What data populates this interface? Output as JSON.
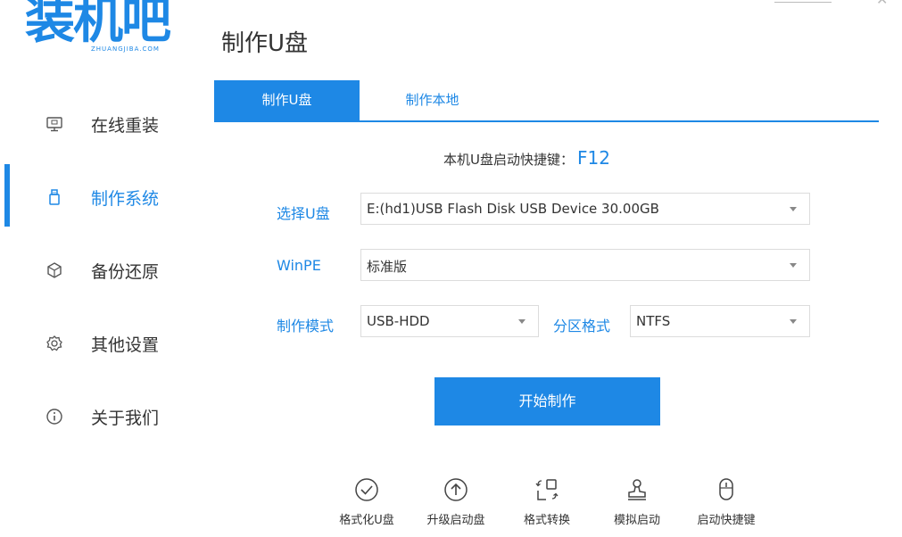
{
  "logo": {
    "main": "装机吧",
    "sub": "ZHUANGJIBA.COM"
  },
  "page_title": "制作U盘",
  "sidebar": {
    "items": [
      {
        "label": "在线重装",
        "icon": "monitor-icon"
      },
      {
        "label": "制作系统",
        "icon": "usb-icon"
      },
      {
        "label": "备份还原",
        "icon": "cube-icon"
      },
      {
        "label": "其他设置",
        "icon": "gear-icon"
      },
      {
        "label": "关于我们",
        "icon": "info-icon"
      }
    ],
    "active_index": 1
  },
  "tabs": [
    {
      "label": "制作U盘",
      "active": true
    },
    {
      "label": "制作本地",
      "active": false
    }
  ],
  "hotkey": {
    "label": "本机U盘启动快捷键：",
    "value": "F12"
  },
  "form": {
    "usb_label": "选择U盘",
    "usb_value": "E:(hd1)USB Flash Disk USB Device 30.00GB",
    "winpe_label": "WinPE",
    "winpe_value": "标准版",
    "mode_label": "制作模式",
    "mode_value": "USB-HDD",
    "partition_label": "分区格式",
    "partition_value": "NTFS"
  },
  "start_button": "开始制作",
  "tools": [
    {
      "label": "格式化U盘",
      "icon": "check-circle-icon"
    },
    {
      "label": "升级启动盘",
      "icon": "upload-icon"
    },
    {
      "label": "格式转换",
      "icon": "convert-icon"
    },
    {
      "label": "模拟启动",
      "icon": "stamp-icon"
    },
    {
      "label": "启动快捷键",
      "icon": "mouse-icon"
    }
  ],
  "colors": {
    "accent": "#1e88e5",
    "text": "#333333",
    "border": "#dcdcdc"
  }
}
